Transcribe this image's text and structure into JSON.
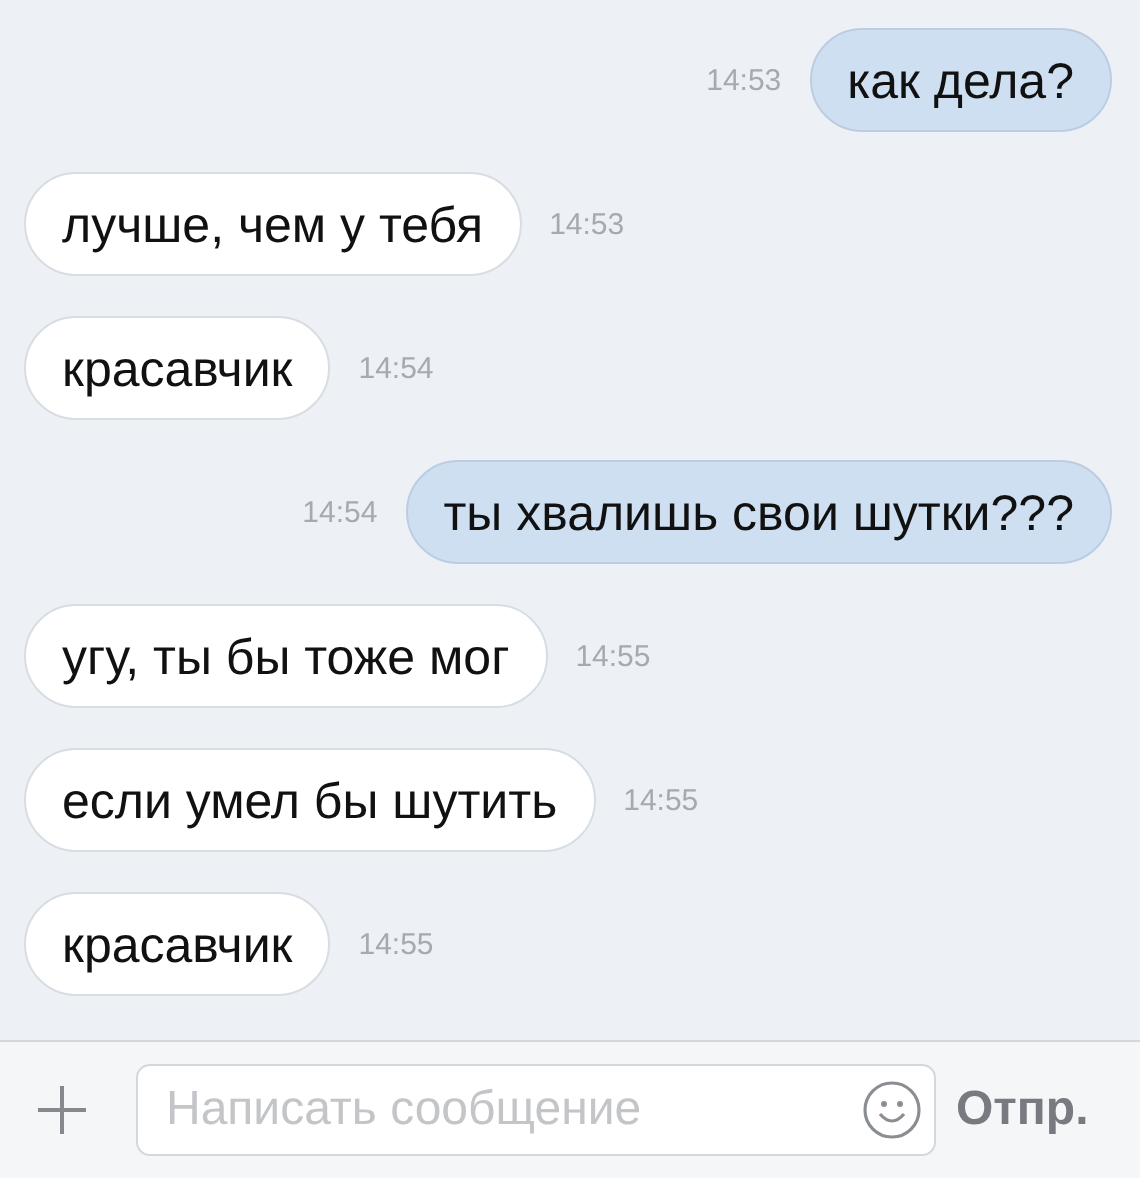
{
  "messages": [
    {
      "kind": "sent",
      "text": "как дела?",
      "time": "14:53"
    },
    {
      "kind": "received",
      "text": "лучше, чем у тебя",
      "time": "14:53"
    },
    {
      "kind": "received",
      "text": "красавчик",
      "time": "14:54"
    },
    {
      "kind": "sent",
      "text": "ты хвалишь свои шутки???",
      "time": "14:54"
    },
    {
      "kind": "received",
      "text": "угу, ты бы тоже мог",
      "time": "14:55"
    },
    {
      "kind": "received",
      "text": "если умел бы шутить",
      "time": "14:55"
    },
    {
      "kind": "received",
      "text": "красавчик",
      "time": "14:55"
    }
  ],
  "composer": {
    "placeholder": "Написать сообщение",
    "send": "Отпр."
  }
}
